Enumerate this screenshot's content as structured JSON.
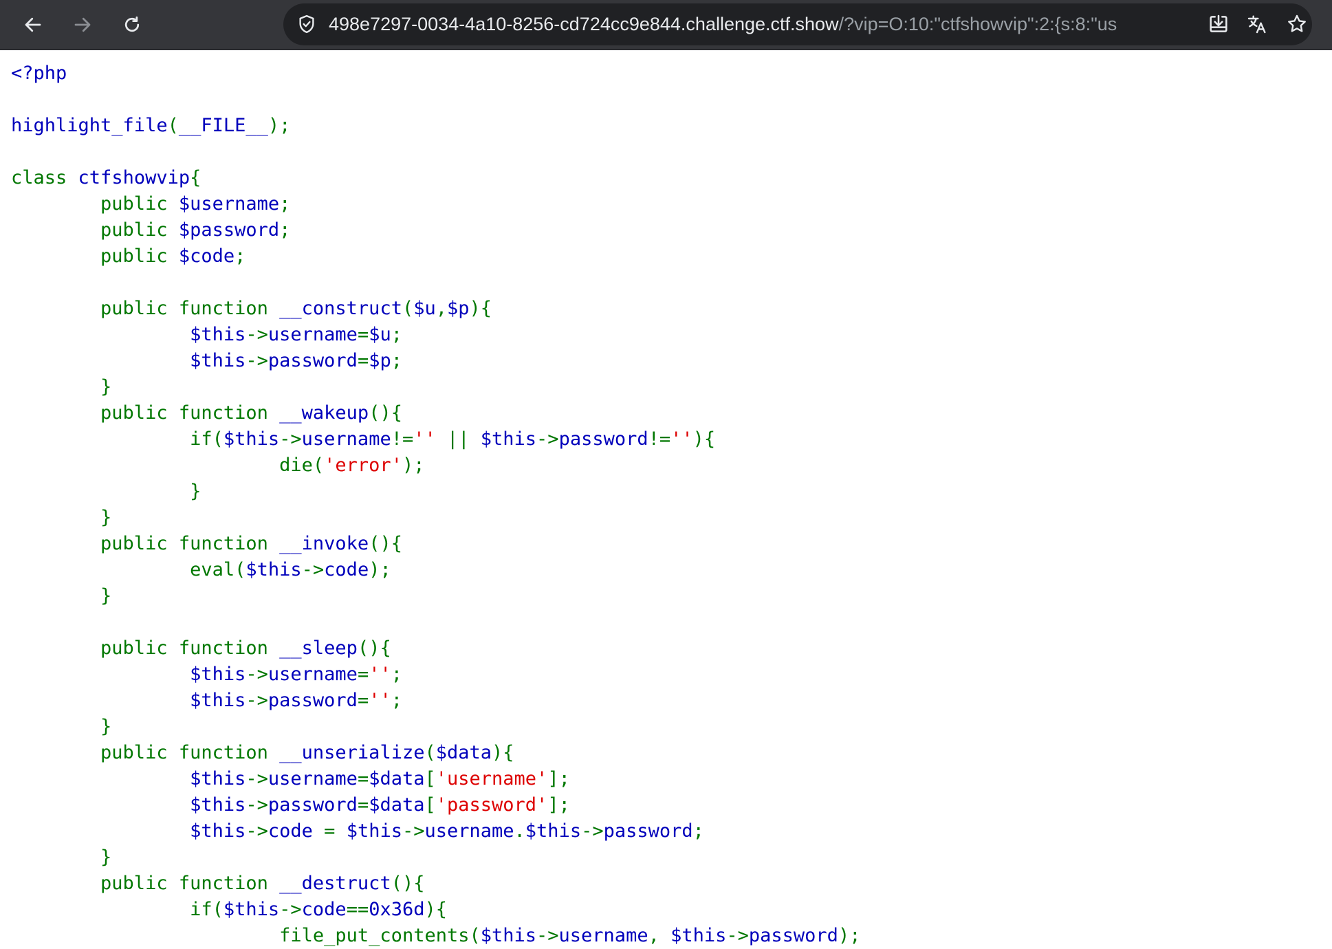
{
  "browser": {
    "url_domain": "498e7297-0034-4a10-8256-cd724cc9e844.challenge.ctf.show",
    "url_rest": "/?vip=O:10:\"ctfshowvip\":2:{s:8:\"us",
    "nav_icons": [
      "back-arrow-icon",
      "forward-arrow-icon",
      "reload-icon"
    ],
    "omnibox_icons": [
      "site-info-shield-icon",
      "install-app-icon",
      "translate-icon",
      "bookmark-star-icon"
    ]
  },
  "colors": {
    "toolbar": "#35363a",
    "omnibox": "#202124",
    "php_default": "#0000bb",
    "php_keyword": "#007700",
    "php_string": "#dd0000"
  },
  "source": {
    "lines": [
      {
        "segments": [
          {
            "c": "df",
            "t": "<?php"
          }
        ]
      },
      {
        "segments": []
      },
      {
        "segments": [
          {
            "c": "df",
            "t": "highlight_file"
          },
          {
            "c": "kw",
            "t": "("
          },
          {
            "c": "df",
            "t": "__FILE__"
          },
          {
            "c": "kw",
            "t": ");"
          }
        ]
      },
      {
        "segments": []
      },
      {
        "segments": [
          {
            "c": "kw",
            "t": "class "
          },
          {
            "c": "df",
            "t": "ctfshowvip"
          },
          {
            "c": "kw",
            "t": "{"
          }
        ]
      },
      {
        "segments": [
          {
            "c": "kw",
            "t": "        public "
          },
          {
            "c": "df",
            "t": "$username"
          },
          {
            "c": "kw",
            "t": ";"
          }
        ]
      },
      {
        "segments": [
          {
            "c": "kw",
            "t": "        public "
          },
          {
            "c": "df",
            "t": "$password"
          },
          {
            "c": "kw",
            "t": ";"
          }
        ]
      },
      {
        "segments": [
          {
            "c": "kw",
            "t": "        public "
          },
          {
            "c": "df",
            "t": "$code"
          },
          {
            "c": "kw",
            "t": ";"
          }
        ]
      },
      {
        "segments": []
      },
      {
        "segments": [
          {
            "c": "kw",
            "t": "        public function "
          },
          {
            "c": "df",
            "t": "__construct"
          },
          {
            "c": "kw",
            "t": "("
          },
          {
            "c": "df",
            "t": "$u"
          },
          {
            "c": "kw",
            "t": ","
          },
          {
            "c": "df",
            "t": "$p"
          },
          {
            "c": "kw",
            "t": "){"
          }
        ]
      },
      {
        "segments": [
          {
            "c": "kw",
            "t": "                "
          },
          {
            "c": "df",
            "t": "$this"
          },
          {
            "c": "kw",
            "t": "->"
          },
          {
            "c": "df",
            "t": "username"
          },
          {
            "c": "kw",
            "t": "="
          },
          {
            "c": "df",
            "t": "$u"
          },
          {
            "c": "kw",
            "t": ";"
          }
        ]
      },
      {
        "segments": [
          {
            "c": "kw",
            "t": "                "
          },
          {
            "c": "df",
            "t": "$this"
          },
          {
            "c": "kw",
            "t": "->"
          },
          {
            "c": "df",
            "t": "password"
          },
          {
            "c": "kw",
            "t": "="
          },
          {
            "c": "df",
            "t": "$p"
          },
          {
            "c": "kw",
            "t": ";"
          }
        ]
      },
      {
        "segments": [
          {
            "c": "kw",
            "t": "        }"
          }
        ]
      },
      {
        "segments": [
          {
            "c": "kw",
            "t": "        public function "
          },
          {
            "c": "df",
            "t": "__wakeup"
          },
          {
            "c": "kw",
            "t": "(){"
          }
        ]
      },
      {
        "segments": [
          {
            "c": "kw",
            "t": "                if("
          },
          {
            "c": "df",
            "t": "$this"
          },
          {
            "c": "kw",
            "t": "->"
          },
          {
            "c": "df",
            "t": "username"
          },
          {
            "c": "kw",
            "t": "!="
          },
          {
            "c": "st",
            "t": "''"
          },
          {
            "c": "kw",
            "t": " || "
          },
          {
            "c": "df",
            "t": "$this"
          },
          {
            "c": "kw",
            "t": "->"
          },
          {
            "c": "df",
            "t": "password"
          },
          {
            "c": "kw",
            "t": "!="
          },
          {
            "c": "st",
            "t": "''"
          },
          {
            "c": "kw",
            "t": "){"
          }
        ]
      },
      {
        "segments": [
          {
            "c": "kw",
            "t": "                        die("
          },
          {
            "c": "st",
            "t": "'error'"
          },
          {
            "c": "kw",
            "t": ");"
          }
        ]
      },
      {
        "segments": [
          {
            "c": "kw",
            "t": "                }"
          }
        ]
      },
      {
        "segments": [
          {
            "c": "kw",
            "t": "        }"
          }
        ]
      },
      {
        "segments": [
          {
            "c": "kw",
            "t": "        public function "
          },
          {
            "c": "df",
            "t": "__invoke"
          },
          {
            "c": "kw",
            "t": "(){"
          }
        ]
      },
      {
        "segments": [
          {
            "c": "kw",
            "t": "                eval("
          },
          {
            "c": "df",
            "t": "$this"
          },
          {
            "c": "kw",
            "t": "->"
          },
          {
            "c": "df",
            "t": "code"
          },
          {
            "c": "kw",
            "t": ");"
          }
        ]
      },
      {
        "segments": [
          {
            "c": "kw",
            "t": "        }"
          }
        ]
      },
      {
        "segments": []
      },
      {
        "segments": [
          {
            "c": "kw",
            "t": "        public function "
          },
          {
            "c": "df",
            "t": "__sleep"
          },
          {
            "c": "kw",
            "t": "(){"
          }
        ]
      },
      {
        "segments": [
          {
            "c": "kw",
            "t": "                "
          },
          {
            "c": "df",
            "t": "$this"
          },
          {
            "c": "kw",
            "t": "->"
          },
          {
            "c": "df",
            "t": "username"
          },
          {
            "c": "kw",
            "t": "="
          },
          {
            "c": "st",
            "t": "''"
          },
          {
            "c": "kw",
            "t": ";"
          }
        ]
      },
      {
        "segments": [
          {
            "c": "kw",
            "t": "                "
          },
          {
            "c": "df",
            "t": "$this"
          },
          {
            "c": "kw",
            "t": "->"
          },
          {
            "c": "df",
            "t": "password"
          },
          {
            "c": "kw",
            "t": "="
          },
          {
            "c": "st",
            "t": "''"
          },
          {
            "c": "kw",
            "t": ";"
          }
        ]
      },
      {
        "segments": [
          {
            "c": "kw",
            "t": "        }"
          }
        ]
      },
      {
        "segments": [
          {
            "c": "kw",
            "t": "        public function "
          },
          {
            "c": "df",
            "t": "__unserialize"
          },
          {
            "c": "kw",
            "t": "("
          },
          {
            "c": "df",
            "t": "$data"
          },
          {
            "c": "kw",
            "t": "){"
          }
        ]
      },
      {
        "segments": [
          {
            "c": "kw",
            "t": "                "
          },
          {
            "c": "df",
            "t": "$this"
          },
          {
            "c": "kw",
            "t": "->"
          },
          {
            "c": "df",
            "t": "username"
          },
          {
            "c": "kw",
            "t": "="
          },
          {
            "c": "df",
            "t": "$data"
          },
          {
            "c": "kw",
            "t": "["
          },
          {
            "c": "st",
            "t": "'username'"
          },
          {
            "c": "kw",
            "t": "];"
          }
        ]
      },
      {
        "segments": [
          {
            "c": "kw",
            "t": "                "
          },
          {
            "c": "df",
            "t": "$this"
          },
          {
            "c": "kw",
            "t": "->"
          },
          {
            "c": "df",
            "t": "password"
          },
          {
            "c": "kw",
            "t": "="
          },
          {
            "c": "df",
            "t": "$data"
          },
          {
            "c": "kw",
            "t": "["
          },
          {
            "c": "st",
            "t": "'password'"
          },
          {
            "c": "kw",
            "t": "];"
          }
        ]
      },
      {
        "segments": [
          {
            "c": "kw",
            "t": "                "
          },
          {
            "c": "df",
            "t": "$this"
          },
          {
            "c": "kw",
            "t": "->"
          },
          {
            "c": "df",
            "t": "code "
          },
          {
            "c": "kw",
            "t": "= "
          },
          {
            "c": "df",
            "t": "$this"
          },
          {
            "c": "kw",
            "t": "->"
          },
          {
            "c": "df",
            "t": "username"
          },
          {
            "c": "kw",
            "t": "."
          },
          {
            "c": "df",
            "t": "$this"
          },
          {
            "c": "kw",
            "t": "->"
          },
          {
            "c": "df",
            "t": "password"
          },
          {
            "c": "kw",
            "t": ";"
          }
        ]
      },
      {
        "segments": [
          {
            "c": "kw",
            "t": "        }"
          }
        ]
      },
      {
        "segments": [
          {
            "c": "kw",
            "t": "        public function "
          },
          {
            "c": "df",
            "t": "__destruct"
          },
          {
            "c": "kw",
            "t": "(){"
          }
        ]
      },
      {
        "segments": [
          {
            "c": "kw",
            "t": "                if("
          },
          {
            "c": "df",
            "t": "$this"
          },
          {
            "c": "kw",
            "t": "->"
          },
          {
            "c": "df",
            "t": "code"
          },
          {
            "c": "kw",
            "t": "=="
          },
          {
            "c": "df",
            "t": "0x36d"
          },
          {
            "c": "kw",
            "t": "){"
          }
        ]
      },
      {
        "segments": [
          {
            "c": "kw",
            "t": "                        file_put_contents("
          },
          {
            "c": "df",
            "t": "$this"
          },
          {
            "c": "kw",
            "t": "->"
          },
          {
            "c": "df",
            "t": "username"
          },
          {
            "c": "kw",
            "t": ", "
          },
          {
            "c": "df",
            "t": "$this"
          },
          {
            "c": "kw",
            "t": "->"
          },
          {
            "c": "df",
            "t": "password"
          },
          {
            "c": "kw",
            "t": ");"
          }
        ]
      }
    ]
  }
}
